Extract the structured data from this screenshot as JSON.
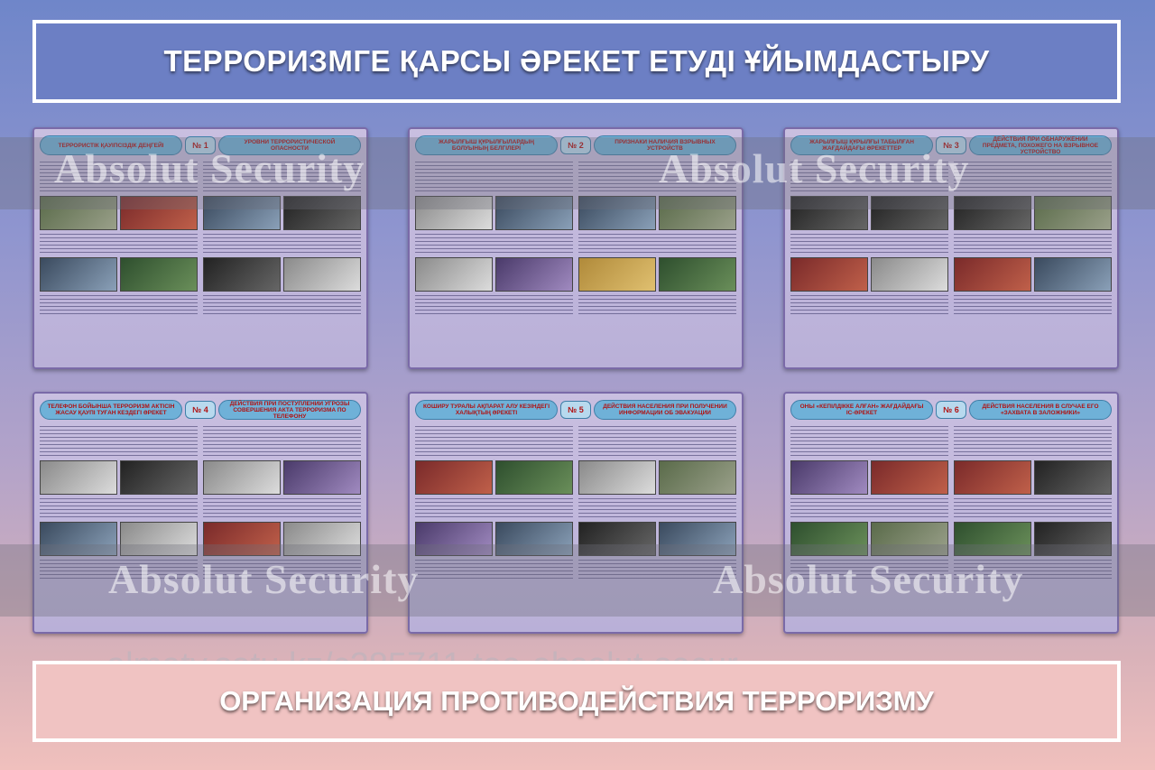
{
  "header": {
    "title": "ТЕРРОРИЗМГЕ ҚАРСЫ ӘРЕКЕТ ЕТУДІ ҰЙЫМДАСТЫРУ"
  },
  "footer": {
    "title": "ОРГАНИЗАЦИЯ ПРОТИВОДЕЙСТВИЯ ТЕРРОРИЗМУ"
  },
  "watermark": {
    "text": "Absolut Security",
    "url": "almaty.satu.kz/c285711-too-absolut-secur…"
  },
  "panels": [
    {
      "number": "№ 1",
      "title_kz": "ТЕРРОРИСТІК ҚАУІПСІЗДІК ДЕҢГЕЙІ",
      "title_ru": "УРОВНИ ТЕРРОРИСТИЧЕСКОЙ ОПАСНОСТИ"
    },
    {
      "number": "№ 2",
      "title_kz": "ЖАРЫЛҒЫШ ҚҰРЫЛҒЫЛАРДЫҢ БОЛУЫНЫҢ БЕЛГІЛЕРІ",
      "title_ru": "ПРИЗНАКИ НАЛИЧИЯ ВЗРЫВНЫХ УСТРОЙСТВ"
    },
    {
      "number": "№ 3",
      "title_kz": "ЖАРЫЛҒЫШ ҚҰРЫЛҒЫ ТАБЫЛҒАН ЖАҒДАЙДАҒЫ ӘРЕКЕТТЕР",
      "title_ru": "ДЕЙСТВИЯ ПРИ ОБНАРУЖЕНИИ ПРЕДМЕТА, ПОХОЖЕГО НА ВЗРЫВНОЕ УСТРОЙСТВО"
    },
    {
      "number": "№ 4",
      "title_kz": "ТЕЛЕФОН БОЙЫНША ТЕРРОРИЗМ АКТІСІН ЖАСАУ ҚАУПІ ТУҒАН КЕЗДЕГІ ӘРЕКЕТ",
      "title_ru": "ДЕЙСТВИЯ ПРИ ПОСТУПЛЕНИИ УГРОЗЫ СОВЕРШЕНИЯ АКТА ТЕРРОРИЗМА ПО ТЕЛЕФОНУ"
    },
    {
      "number": "№ 5",
      "title_kz": "КОШИРУ ТУРАЛЫ АҚПАРАТ АЛУ КЕЗІНДЕГІ ХАЛЫҚТЫҢ ӘРЕКЕТІ",
      "title_ru": "ДЕЙСТВИЯ НАСЕЛЕНИЯ ПРИ ПОЛУЧЕНИИ ИНФОРМАЦИИ ОБ ЭВАКУАЦИИ"
    },
    {
      "number": "№ 6",
      "title_kz": "ОНЫ «КЕПІЛДІККЕ АЛҒАН» ЖАҒДАЙДАҒЫ ІС-ӘРЕКЕТ",
      "title_ru": "ДЕЙСТВИЯ НАСЕЛЕНИЯ В СЛУЧАЕ ЕГО «ЗАХВАТА В ЗАЛОЖНИКИ»"
    }
  ]
}
